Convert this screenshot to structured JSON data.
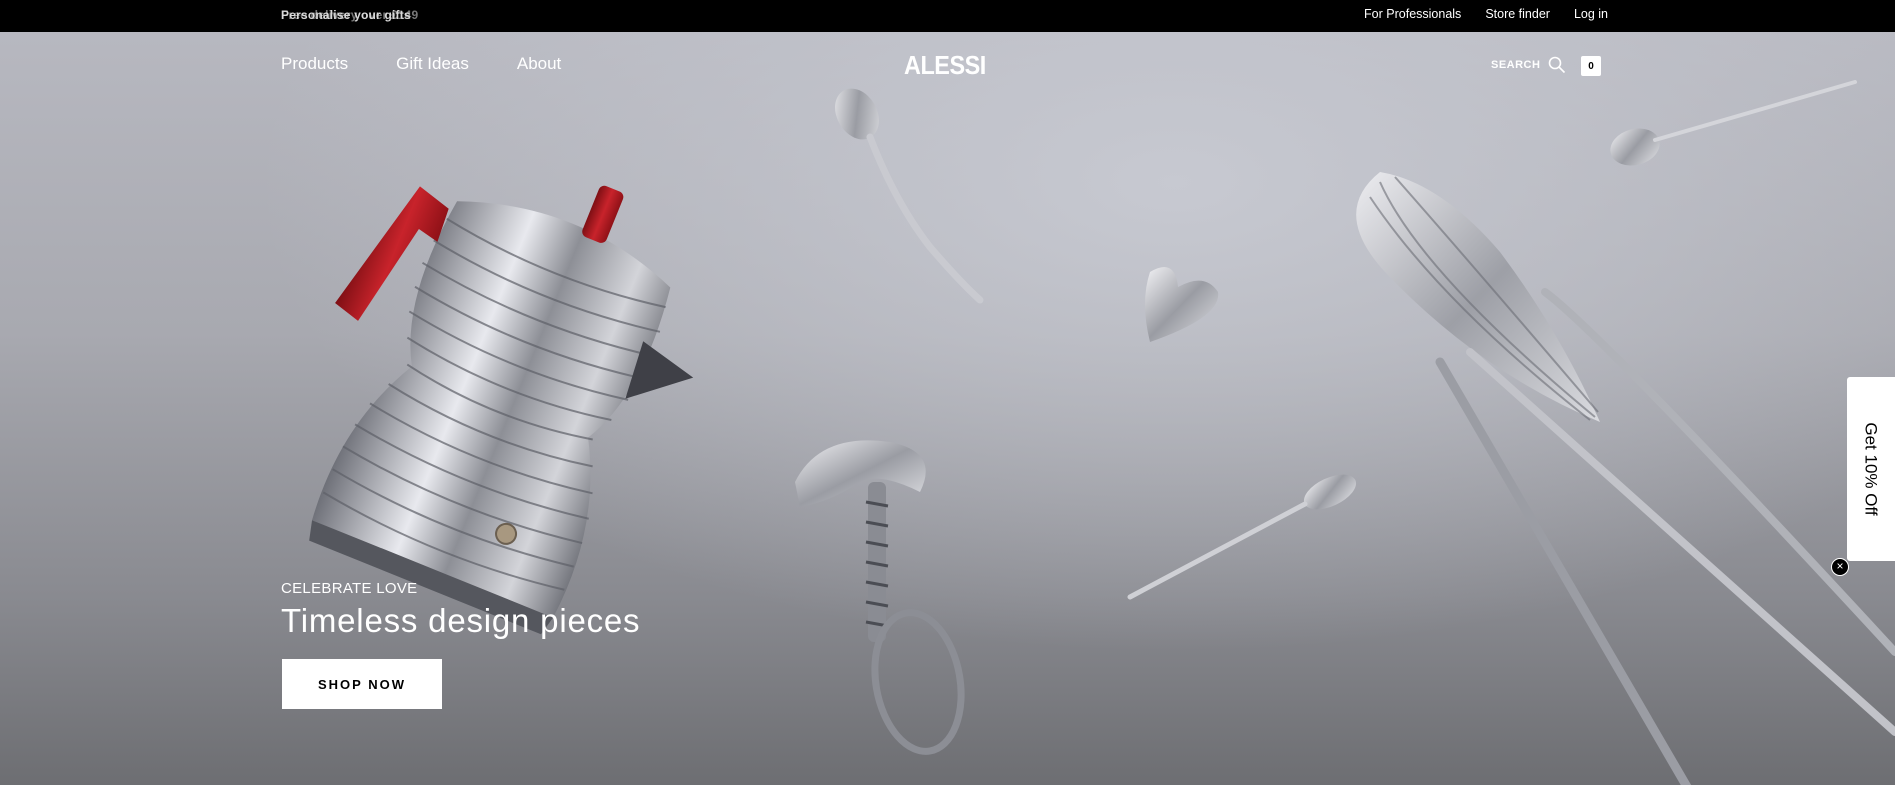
{
  "topbar": {
    "announcement": "Personalise your gifts",
    "announcement_ghost": "Free delivery over £149",
    "links": {
      "professionals": "For Professionals",
      "store_finder": "Store finder",
      "login": "Log in"
    }
  },
  "header": {
    "nav": {
      "products": "Products",
      "gift_ideas": "Gift Ideas",
      "about": "About"
    },
    "logo": "ALESSI",
    "search_label": "SEARCH",
    "search_icon": "search-icon",
    "cart_count": "0"
  },
  "hero": {
    "eyebrow": "CELEBRATE LOVE",
    "headline": "Timeless design pieces",
    "cta": "SHOP NOW"
  },
  "discount": {
    "label": "Get 10% Off",
    "close_icon": "close-icon",
    "close_glyph": "×"
  },
  "colors": {
    "topbar_bg": "#000000",
    "handle_red": "#b3171f",
    "cta_bg": "#ffffff",
    "text_on_hero": "#ffffff"
  }
}
